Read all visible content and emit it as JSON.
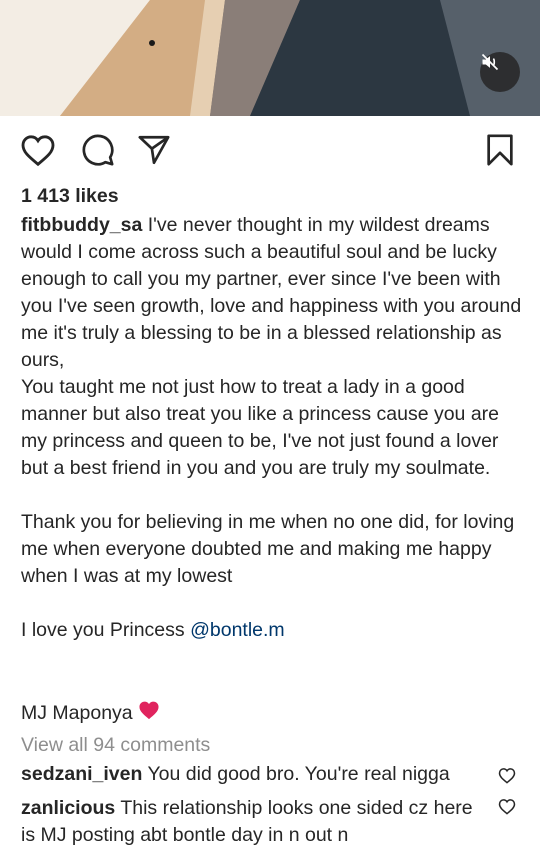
{
  "post": {
    "likes": "1 413 likes",
    "username": "fitbbuddy_sa",
    "caption_para1": "I've never thought in my wildest dreams would I come across such a beautiful soul and be lucky enough to call you my partner, ever since I've been with you I've seen growth, love and happiness with you around me it's truly a blessing to be in a blessed relationship as ours,",
    "caption_para2": "You taught me not just how to treat a lady in a good manner but also treat you like a princess cause you are my princess and queen to be, I've not just found a lover but a best friend in you and you are truly my soulmate.",
    "caption_para3": "Thank you for believing in me when no one did, for loving me when everyone doubted me and making me happy when I was at my lowest",
    "caption_para4_prefix": "I love you Princess ",
    "caption_mention": "@bontle.m",
    "author_line": "MJ Maponya"
  },
  "comments_link": "View all 94 comments",
  "comments": [
    {
      "username": "sedzani_iven",
      "text": " You did good bro. You're real nigga"
    },
    {
      "username": "zanlicious",
      "text": " This relationship looks one sided cz here is MJ posting abt bontle day in n out  n"
    }
  ],
  "icons": {
    "like": "heart-outline-icon",
    "comment": "comment-bubble-icon",
    "share": "paper-plane-icon",
    "save": "bookmark-icon",
    "mute": "speaker-muted-icon",
    "author_emoji": "red-heart-emoji"
  },
  "colors": {
    "text": "#262626",
    "muted": "#8e8e8e",
    "mention": "#00376b",
    "heart": "#e0245e"
  }
}
